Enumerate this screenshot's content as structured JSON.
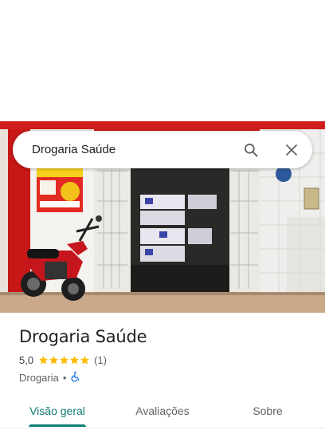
{
  "search": {
    "query": "Drogaria Saúde"
  },
  "place": {
    "name": "Drogaria Saúde",
    "rating": "5,0",
    "stars": 5,
    "review_count": "(1)",
    "category": "Drogaria",
    "separator": "•"
  },
  "tabs": [
    {
      "label": "Visão geral",
      "active": true
    },
    {
      "label": "Avaliações",
      "active": false
    },
    {
      "label": "Sobre",
      "active": false
    }
  ],
  "colors": {
    "accent": "#0f7d74",
    "star": "#fbbc04",
    "accessibility": "#1a73e8"
  },
  "icons": {
    "search": "search-icon",
    "close": "close-icon",
    "accessible": "wheelchair-icon"
  }
}
